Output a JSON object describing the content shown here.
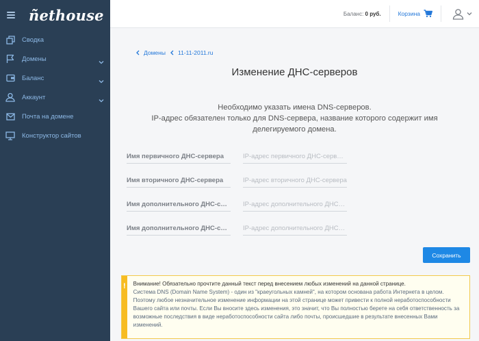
{
  "brand": {
    "logo": "ñethouse"
  },
  "sidebar": {
    "items": [
      {
        "label": "Сводка",
        "icon": "copy-icon",
        "has_children": false
      },
      {
        "label": "Домены",
        "icon": "flag-icon",
        "has_children": true
      },
      {
        "label": "Баланс",
        "icon": "wallet-icon",
        "has_children": true
      },
      {
        "label": "Аккаунт",
        "icon": "user-icon",
        "has_children": true
      },
      {
        "label": "Почта на домене",
        "icon": "mail-icon",
        "has_children": false
      },
      {
        "label": "Конструктор сайтов",
        "icon": "monitor-icon",
        "has_children": false
      }
    ]
  },
  "header": {
    "balance_label": "Баланс:",
    "balance_value": "0 руб.",
    "cart_label": "Корзина"
  },
  "breadcrumbs": [
    "Домены",
    "11-11-2011.ru"
  ],
  "page": {
    "title": "Изменение ДНС-серверов",
    "desc_line1": "Необходимо указать имена DNS-серверов.",
    "desc_line2": "IP-адрес обязателен только для DNS-сервера, название которого содержит имя",
    "desc_line3": "делегируемого домена."
  },
  "form": {
    "rows": [
      {
        "name_placeholder": "Имя первичного ДНС-сервера",
        "ip_placeholder": "IP-адрес первичного ДНС-сервера"
      },
      {
        "name_placeholder": "Имя вторичного ДНС-сервера",
        "ip_placeholder": "IP-адрес вторичного ДНС-сервера"
      },
      {
        "name_placeholder": "Имя дополнительного ДНС-сервера",
        "ip_placeholder": "IP-адрес дополнительного ДНС-сервера"
      },
      {
        "name_placeholder": "Имя дополнительного ДНС-сервера",
        "ip_placeholder": "IP-адрес дополнительного ДНС-сервера"
      }
    ],
    "save_label": "Сохранить"
  },
  "warning": {
    "icon": "!",
    "headline": "Внимание! Обязательно прочтите данный текст перед внесением любых изменений на данной странице.",
    "body": "Система DNS (Domain Name System) - один из \"краеугольных камней\", на котором основана работа Интернета в целом. Поэтому любое незначительное изменение информации на этой странице может привести к полной неработоспособности Вашего сайта или почты. Если Вы вносите здесь изменения, это значит, что Вы полностью берете на себя ответственность за возможные последствия в виде неработоспособности сайта либо почты, происшедшие в результате внесенных Вами изменений."
  },
  "colors": {
    "sidebar_bg": "#2a3f55",
    "accent": "#1e88e5",
    "warning": "#f7bc22"
  }
}
